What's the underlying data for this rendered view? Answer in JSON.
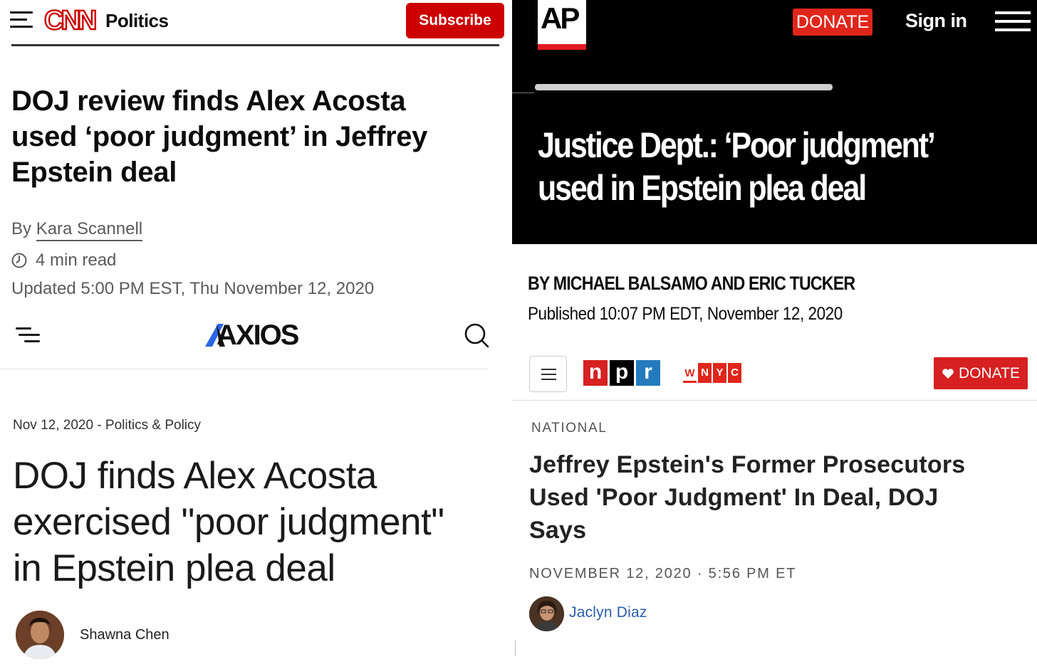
{
  "cnn": {
    "logo": "CNN",
    "section": "Politics",
    "subscribe_label": "Subscribe",
    "headline_lines": [
      "DOJ review finds Alex Acosta",
      "used ‘poor judgment’ in Jeffrey",
      "Epstein deal"
    ],
    "byline_prefix": "By ",
    "author": "Kara Scannell",
    "read_time": "4 min read",
    "updated": "Updated 5:00 PM EST, Thu November 12, 2020",
    "brand_color": "#cc0000"
  },
  "axios": {
    "logo": "AXIOS",
    "meta": "Nov 12, 2020 - Politics & Policy",
    "headline_lines": [
      "DOJ finds Alex Acosta",
      "exercised \"poor judgment\"",
      "in Epstein plea deal"
    ],
    "author": "Shawna Chen",
    "brand_color": "#2a66e6"
  },
  "ap": {
    "logo": "AP",
    "donate_label": "DONATE",
    "signin_label": "Sign in",
    "headline_lines": [
      "Justice Dept.: ‘Poor judgment’",
      "used in Epstein plea deal"
    ],
    "byline": "BY  MICHAEL BALSAMO AND ERIC TUCKER",
    "published": "Published 10:07 PM EDT, November 12, 2020",
    "accent_color": "#e0261b"
  },
  "npr": {
    "logo_letters": [
      "n",
      "p",
      "r"
    ],
    "logo_colors": [
      "#d62021",
      "#000000",
      "#237bbd"
    ],
    "station_letters": [
      "W",
      "N",
      "Y",
      "C"
    ],
    "donate_label": "DONATE",
    "section": "NATIONAL",
    "headline_lines": [
      "Jeffrey Epstein's Former Prosecutors",
      "Used 'Poor Judgment' In Deal, DOJ",
      "Says"
    ],
    "date": "NOVEMBER 12, 2020 · 5:56 PM ET",
    "author": "Jaclyn Diaz",
    "link_color": "#2b5dab"
  }
}
